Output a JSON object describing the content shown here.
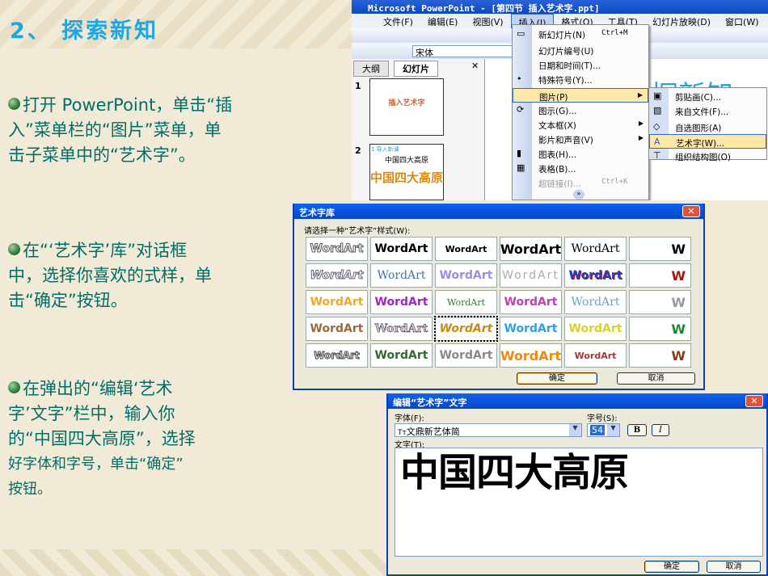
{
  "slide": {
    "title": "2、 探索新知",
    "paragraphs": [
      {
        "lines": [
          "打开 PowerPoint，单击“插",
          "入”菜单栏的“图片”菜单，单",
          "击子菜单中的“艺术字”。"
        ]
      },
      {
        "lines": [
          "在“‘艺术字’库”对话框",
          "中，选择你喜欢的式样，单",
          "击“确定”按钮。"
        ]
      },
      {
        "lines": [
          "在弹出的“编辑‘艺术",
          "字’文字”栏中，输入你",
          "的“中国四大高原”，选择",
          "好字体和字号，单击“确定”",
          "按钮。"
        ]
      }
    ]
  },
  "ppt": {
    "title": "Microsoft PowerPoint - [第四节    插入艺术字.ppt]",
    "menus": [
      "文件(F)",
      "编辑(E)",
      "视图(V)",
      "插入(I)",
      "格式(O)",
      "工具(T)",
      "幻灯片放映(D)",
      "窗口(W)"
    ],
    "font": "宋体",
    "tabs": [
      "大纲",
      "幻灯片"
    ],
    "thumbs": [
      {
        "num": "1",
        "title": "插入艺术字"
      },
      {
        "num": "2",
        "heading": "1 导入新课",
        "title": "中国四大高原",
        "art": "中国四大高原"
      }
    ],
    "insert_menu": [
      {
        "label": "新幻灯片(N)",
        "shortcut": "Ctrl+M"
      },
      {
        "label": "幻灯片编号(U)"
      },
      {
        "label": "日期和时间(T)..."
      },
      {
        "label": "特殊符号(Y)..."
      },
      {
        "label": "图片(P)",
        "submenu": true
      },
      {
        "label": "图示(G)..."
      },
      {
        "label": "文本框(X)",
        "submenu": true
      },
      {
        "label": "影片和声音(V)",
        "submenu": true
      },
      {
        "label": "图表(H)..."
      },
      {
        "label": "表格(B)..."
      },
      {
        "label": "超链接(I)...",
        "shortcut": "Ctrl+K"
      }
    ],
    "picture_submenu": [
      "剪贴画(C)...",
      "来自文件(F)...",
      "自选图形(A)",
      "艺术字(W)...",
      "组织结构图(O)"
    ],
    "bg_text": "探新知"
  },
  "gallery": {
    "title": "艺术字库",
    "prompt": "请选择一种“艺术字”样式(W):",
    "sample": "WordArt",
    "sample_w": "W",
    "ok": "确定",
    "cancel": "取消"
  },
  "edit": {
    "title": "编辑“艺术字”文字",
    "font_label": "字体(F):",
    "font_value": "文鼎新艺体简",
    "size_label": "字号(S):",
    "size_value": "54",
    "bold": "B",
    "italic": "I",
    "text_label": "文字(T):",
    "text_value": "中国四大高原",
    "ok": "确定",
    "cancel": "取消"
  }
}
